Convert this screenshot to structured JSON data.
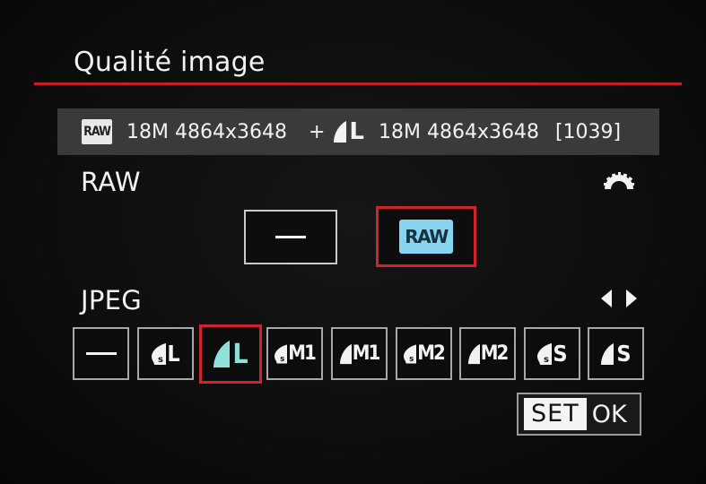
{
  "screen": {
    "title": "Qualité image",
    "accent_color": "#c81a24"
  },
  "summary": {
    "raw_icon_label": "RAW",
    "raw_size": "18M 4864x3648",
    "plus": "+",
    "jpeg_icon": "fine-quality-icon",
    "jpeg_quality_letter": "L",
    "jpeg_size": "18M 4864x3648",
    "shots_remaining": "[1039]"
  },
  "raw_section": {
    "label": "RAW",
    "dial_icon": "main-dial-icon",
    "options": [
      {
        "label": "—",
        "selected": false
      },
      {
        "label": "RAW",
        "selected": true
      }
    ]
  },
  "jpeg_section": {
    "label": "JPEG",
    "nav_icon": "left-right-arrows-icon",
    "options": [
      {
        "prefix": "",
        "label": "—",
        "fine": false,
        "selected": false
      },
      {
        "prefix": "s",
        "label": "L",
        "fine": false,
        "selected": false
      },
      {
        "prefix": "",
        "label": "L",
        "fine": true,
        "selected": true
      },
      {
        "prefix": "s",
        "label": "M1",
        "fine": false,
        "selected": false
      },
      {
        "prefix": "",
        "label": "M1",
        "fine": true,
        "selected": false
      },
      {
        "prefix": "s",
        "label": "M2",
        "fine": false,
        "selected": false
      },
      {
        "prefix": "",
        "label": "M2",
        "fine": true,
        "selected": false
      },
      {
        "prefix": "s",
        "label": "S",
        "fine": false,
        "selected": false
      },
      {
        "prefix": "",
        "label": "S",
        "fine": true,
        "selected": false
      }
    ]
  },
  "set_ok": {
    "set_label": "SET",
    "ok_label": "OK"
  }
}
